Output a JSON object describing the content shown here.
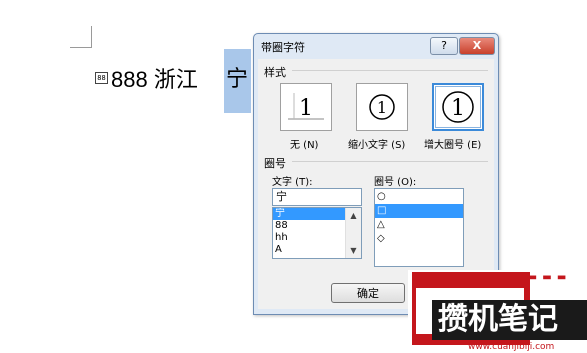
{
  "document": {
    "prefix_enclosed": "88",
    "text": "888 浙江",
    "selected_char": "宁"
  },
  "dialog": {
    "title": "带圈字符",
    "help_label": "?",
    "close_label": "X",
    "style_section_label": "样式",
    "style_options": [
      {
        "glyph": "1",
        "caption": "无 (N)"
      },
      {
        "glyph": "①",
        "caption": "缩小文字 (S)"
      },
      {
        "glyph": "①",
        "caption": "增大圈号 (E)",
        "selected": true
      }
    ],
    "circle_section_label": "圈号",
    "text_label": "文字 (T):",
    "text_value": "宁",
    "text_list": [
      "宁",
      "88",
      "hh",
      "A"
    ],
    "circle_label": "圈号 (O):",
    "circle_list": [
      "○",
      "□",
      "△",
      "◇"
    ],
    "ok_label": "确定"
  },
  "watermark": {
    "text": "攒机笔记",
    "url": "www.cuanjibiji.com"
  }
}
